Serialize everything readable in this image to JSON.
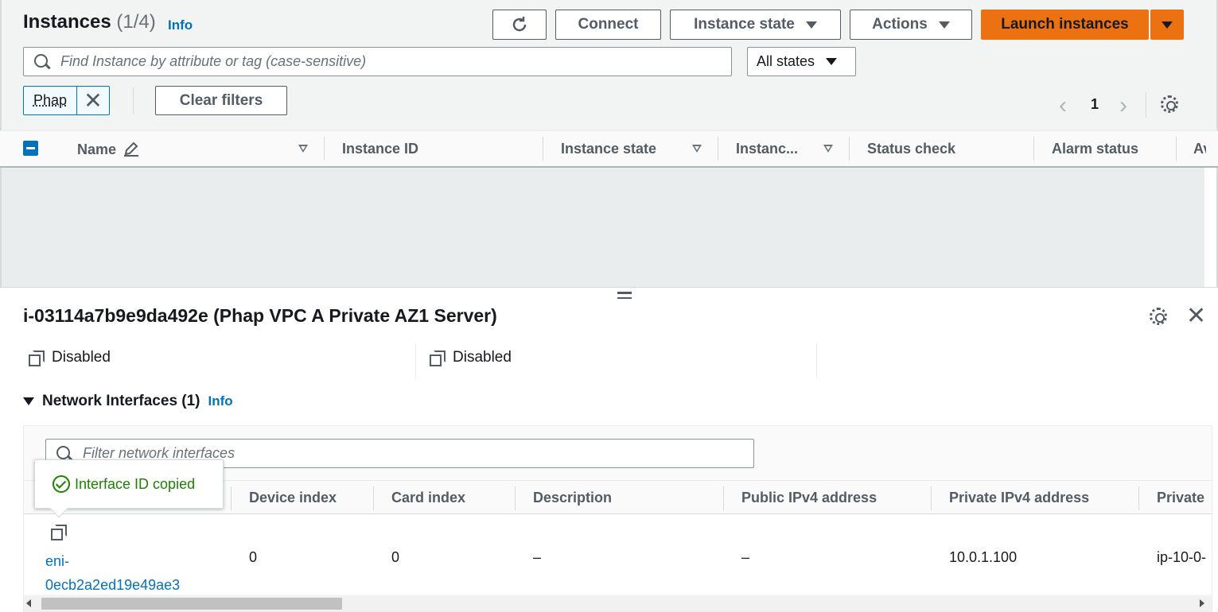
{
  "instances": {
    "title": "Instances",
    "count": "(1/4)",
    "info": "Info"
  },
  "toolbar": {
    "refresh_icon": "refresh-icon",
    "connect": "Connect",
    "instance_state": "Instance state",
    "actions": "Actions",
    "launch": "Launch instances"
  },
  "search": {
    "placeholder": "Find Instance by attribute or tag (case-sensitive)"
  },
  "state_filter": {
    "selected": "All states"
  },
  "filter_token": {
    "label": "Phap"
  },
  "clear_filters": "Clear filters",
  "pagination": {
    "page": "1"
  },
  "table": {
    "columns": [
      "Name",
      "Instance ID",
      "Instance state",
      "Instanc...",
      "Status check",
      "Alarm status",
      "Av"
    ]
  },
  "detail": {
    "title": "i-03114a7b9e9da492e (Phap VPC A Private AZ1 Server)",
    "values": [
      "Disabled",
      "Disabled"
    ]
  },
  "network_interfaces": {
    "heading": "Network Interfaces (1)",
    "info": "Info",
    "search_placeholder": "Filter network interfaces",
    "columns": [
      "Device index",
      "Card index",
      "Description",
      "Public IPv4 address",
      "Private IPv4 address",
      "Private"
    ],
    "row": {
      "interface_id_line1": "eni-",
      "interface_id_line2": "0ecb2a2ed19e49ae3",
      "device_index": "0",
      "card_index": "0",
      "description": "–",
      "public_ipv4": "–",
      "private_ipv4": "10.0.1.100",
      "private_dns": "ip-10-0-"
    }
  },
  "popover": {
    "message": "Interface ID copied"
  },
  "colors": {
    "primary": "#ec7211",
    "link": "#0073bb",
    "success": "#1d8102"
  }
}
